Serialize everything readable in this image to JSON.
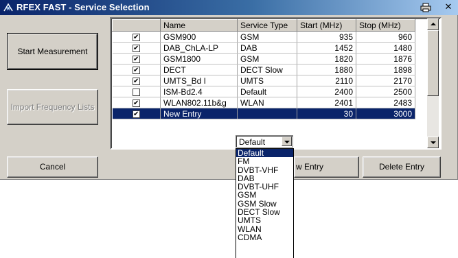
{
  "window": {
    "title": "RFEX FAST - Service Selection",
    "title_icon": "rfex-app-icon",
    "print_icon": "printer-icon",
    "close_glyph": "✕"
  },
  "buttons": {
    "start": "Start Measurement",
    "import": "Import Frequency Lists",
    "cancel": "Cancel",
    "new_entry": "w Entry",
    "delete_entry": "Delete Entry"
  },
  "table": {
    "columns": [
      "Name",
      "Service Type",
      "Start (MHz)",
      "Stop (MHz)"
    ],
    "rows": [
      {
        "checked": true,
        "checkmark": "✔",
        "name": "GSM900",
        "type": "GSM",
        "start": "935",
        "stop": "960"
      },
      {
        "checked": true,
        "checkmark": "✔",
        "name": "DAB_ChLA-LP",
        "type": "DAB",
        "start": "1452",
        "stop": "1480"
      },
      {
        "checked": true,
        "checkmark": "✔",
        "name": "GSM1800",
        "type": "GSM",
        "start": "1820",
        "stop": "1876"
      },
      {
        "checked": true,
        "checkmark": "✔",
        "name": "DECT",
        "type": "DECT Slow",
        "start": "1880",
        "stop": "1898"
      },
      {
        "checked": true,
        "checkmark": "✔",
        "name": "UMTS_Bd I",
        "type": "UMTS",
        "start": "2110",
        "stop": "2170"
      },
      {
        "checked": false,
        "checkmark": "",
        "name": "ISM-Bd2.4",
        "type": "Default",
        "start": "2400",
        "stop": "2500"
      },
      {
        "checked": true,
        "checkmark": "✔",
        "name": "WLAN802.11b&g",
        "type": "WLAN",
        "start": "2401",
        "stop": "2483"
      },
      {
        "checked": true,
        "checkmark": "✔",
        "name": "New Entry",
        "type": "",
        "start": "30",
        "stop": "3000"
      }
    ],
    "selected_row": 7
  },
  "service_combo": {
    "value": "Default",
    "options": [
      "Default",
      "FM",
      "DVBT-VHF",
      "DAB",
      "DVBT-UHF",
      "GSM",
      "GSM Slow",
      "DECT Slow",
      "UMTS",
      "WLAN",
      "CDMA"
    ],
    "highlighted": "Default"
  },
  "colors": {
    "selection": "#0a246a",
    "face": "#d4d0c8",
    "title_start": "#0a246a",
    "title_end": "#a6caf0"
  }
}
